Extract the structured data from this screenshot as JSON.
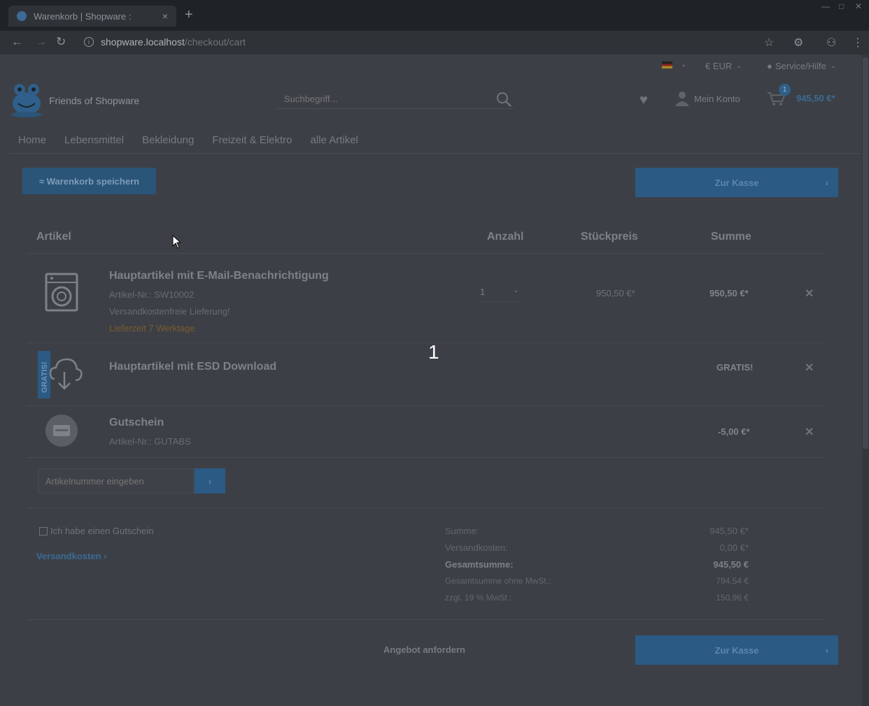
{
  "browser": {
    "tab_title": "Warenkorb | Shopware :",
    "tab_close": "×",
    "new_tab": "+",
    "url_host": "shopware.localhost",
    "url_path": "/checkout/cart"
  },
  "topbar": {
    "currency": "€ EUR",
    "service": "Service/Hilfe"
  },
  "header": {
    "brand": "Friends of Shopware",
    "search_placeholder": "Suchbegriff...",
    "account_label": "Mein Konto",
    "cart_count": "1",
    "cart_total": "945,50 €*"
  },
  "nav": {
    "items": [
      "Home",
      "Lebensmittel",
      "Bekleidung",
      "Freizeit & Elektro",
      "alle Artikel"
    ]
  },
  "actions": {
    "save_cart": "≈ Warenkorb speichern",
    "checkout": "Zur Kasse",
    "checkout_arrow": "›",
    "request_offer": "Angebot anfordern"
  },
  "table": {
    "col_article": "Artikel",
    "col_quantity": "Anzahl",
    "col_unit_price": "Stückpreis",
    "col_sum": "Summe",
    "remove_glyph": "✕"
  },
  "items": [
    {
      "title": "Hauptartikel mit E-Mail-Benachrichtigung",
      "article_no": "Artikel-Nr.: SW10002",
      "shipping_note": "Versandkostenfreie Lieferung!",
      "delivery": "Lieferzeit 7 Werktage",
      "quantity": "1",
      "unit_price": "950,50 €*",
      "sum": "950,50 €*"
    },
    {
      "title": "Hauptartikel mit ESD Download",
      "badge": "GRATIS!",
      "sum": "GRATIS!"
    },
    {
      "title": "Gutschein",
      "article_no": "Artikel-Nr.: GUTABS",
      "sum": "-5,00 €*"
    }
  ],
  "add_article": {
    "placeholder": "Artikelnummer eingeben",
    "button": "›"
  },
  "voucher": {
    "label": "Ich habe einen Gutschein"
  },
  "shipping_link": "Versandkosten ›",
  "summary": {
    "subtotal_label": "Summe:",
    "subtotal": "945,50 €*",
    "shipping_label": "Versandkosten:",
    "shipping": "0,00 €*",
    "total_label": "Gesamtsumme:",
    "total": "945,50 €",
    "net_label": "Gesamtsumme ohne MwSt.:",
    "net": "794,54 €",
    "vat_label": "zzgl. 19 % MwSt.:",
    "vat": "150,96 €"
  },
  "overlay_number": "1",
  "colors": {
    "accent": "#2b5a84",
    "background_dimmed": "#3c4046",
    "chrome": "#202326"
  }
}
